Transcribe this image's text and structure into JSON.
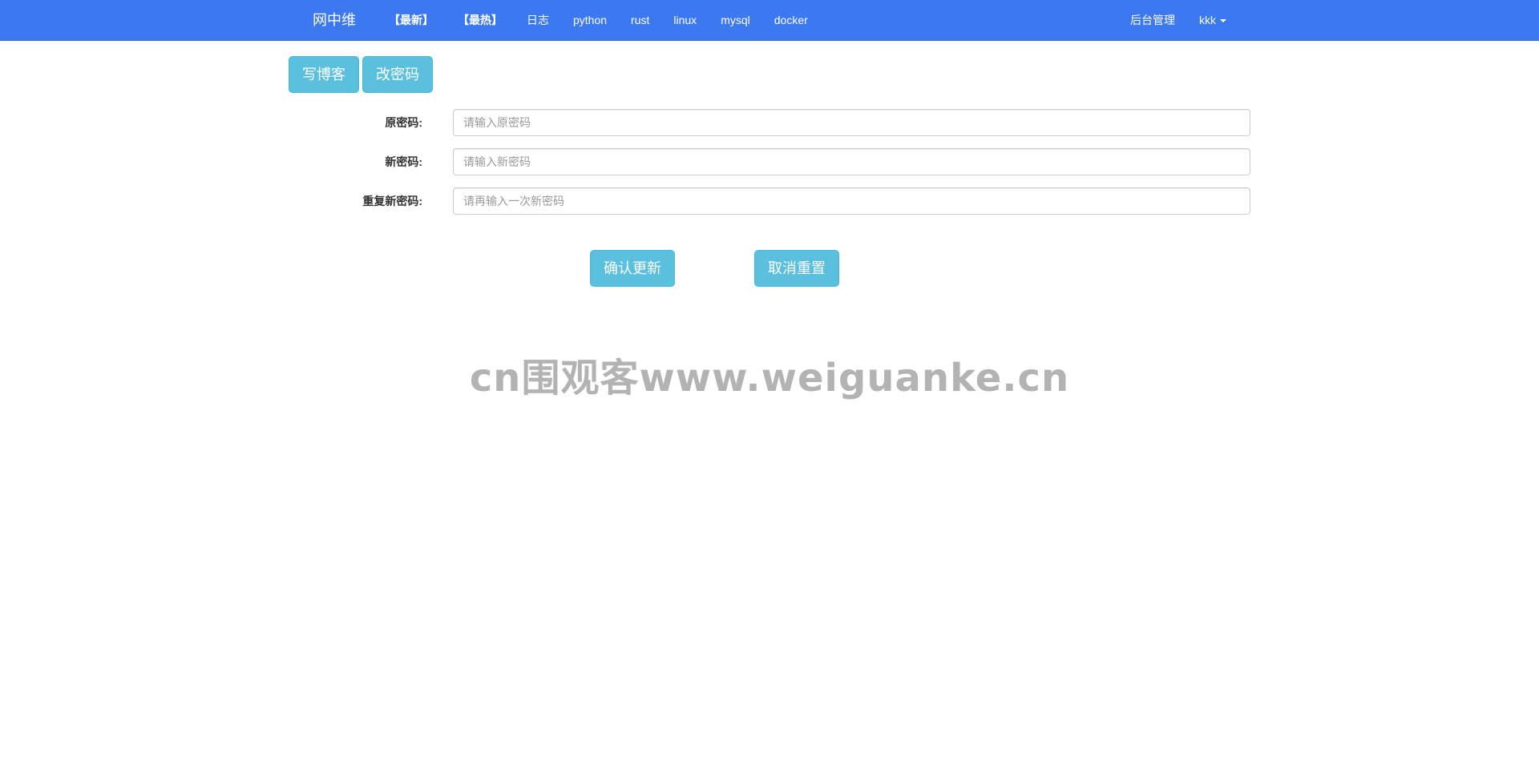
{
  "navbar": {
    "brand": "网中维",
    "links": [
      "【最新】",
      "【最热】",
      "日志",
      "python",
      "rust",
      "linux",
      "mysql",
      "docker"
    ],
    "admin": "后台管理",
    "user": "kkk",
    "bg_color": "#3c78f0"
  },
  "toolbar": {
    "write_blog": "写博客",
    "change_password": "改密码"
  },
  "form": {
    "old_password": {
      "label": "原密码:",
      "placeholder": "请输入原密码",
      "value": ""
    },
    "new_password": {
      "label": "新密码:",
      "placeholder": "请输入新密码",
      "value": ""
    },
    "repeat_password": {
      "label": "重复新密码:",
      "placeholder": "请再输入一次新密码",
      "value": ""
    },
    "confirm": "确认更新",
    "cancel": "取消重置"
  },
  "watermark": "cn围观客www.weiguanke.cn",
  "colors": {
    "button": "#5bc0de",
    "button_border": "#46b8da"
  }
}
